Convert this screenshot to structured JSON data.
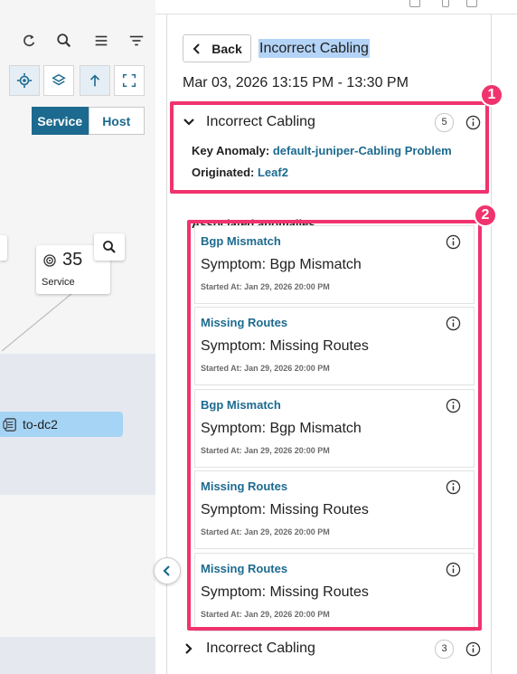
{
  "topology": {
    "toolbar_icons": [
      "refresh-icon",
      "search-icon",
      "list-icon",
      "filter-icon"
    ],
    "view_icons": [
      "locate-icon",
      "layers-icon",
      "arrow-up-icon",
      "fullscreen-icon"
    ],
    "toggle": {
      "service_label": "Service",
      "host_label": "Host",
      "selected": "Service"
    },
    "node": {
      "count": "35",
      "label": "Service"
    },
    "device": {
      "label": "to-dc2"
    }
  },
  "panel": {
    "back_label": "Back",
    "title": "Incorrect Cabling",
    "time_range": "Mar 03, 2026 13:15 PM - 13:30 PM",
    "primary": {
      "title": "Incorrect Cabling",
      "count": "5",
      "expanded": true,
      "key_anomaly_label": "Key Anomaly:",
      "key_anomaly_value": "default-juniper-Cabling Problem",
      "originated_label": "Originated:",
      "originated_value": "Leaf2"
    },
    "associated_label": "Associated anomalies",
    "anomalies": [
      {
        "name": "Bgp Mismatch",
        "symptom": "Symptom: Bgp Mismatch",
        "started": "Started At: Jan 29, 2026 20:00 PM"
      },
      {
        "name": "Missing Routes",
        "symptom": "Symptom: Missing Routes",
        "started": "Started At: Jan 29, 2026 20:00 PM"
      },
      {
        "name": "Bgp Mismatch",
        "symptom": "Symptom: Bgp Mismatch",
        "started": "Started At: Jan 29, 2026 20:00 PM"
      },
      {
        "name": "Missing Routes",
        "symptom": "Symptom: Missing Routes",
        "started": "Started At: Jan 29, 2026 20:00 PM"
      },
      {
        "name": "Missing Routes",
        "symptom": "Symptom: Missing Routes",
        "started": "Started At: Jan 29, 2026 20:00 PM"
      }
    ],
    "secondary": {
      "title": "Incorrect Cabling",
      "count": "3",
      "expanded": false
    }
  },
  "callouts": [
    "1",
    "2"
  ],
  "colors": {
    "accent": "#1c6a8f",
    "highlight": "#f0336e",
    "selection": "#b4d4f7",
    "device_fill": "#a6d4f5"
  }
}
